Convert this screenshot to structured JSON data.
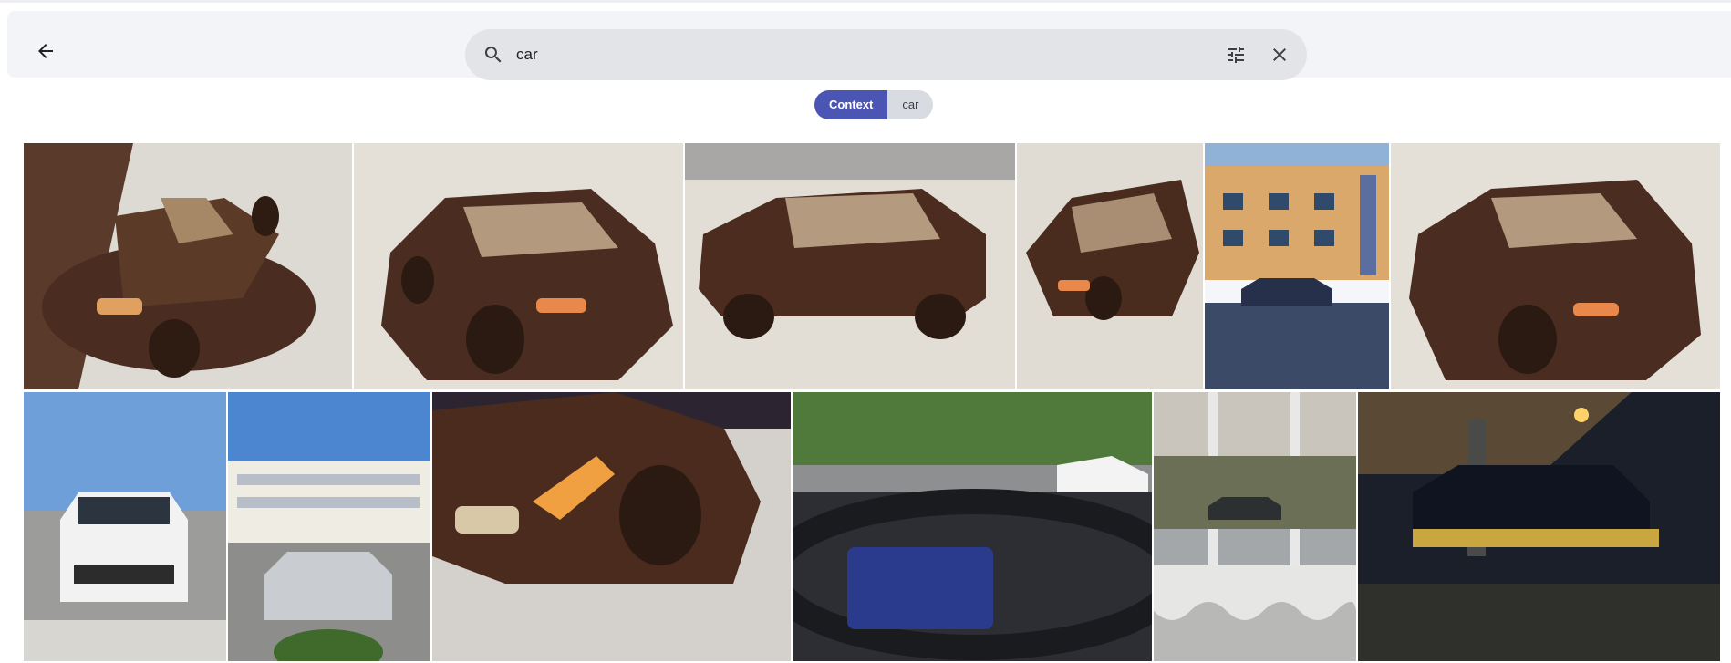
{
  "search": {
    "query": "car",
    "icon": "search-icon"
  },
  "toolbar": {
    "back_icon": "arrow-back-icon",
    "filter_icon": "tune-icon",
    "clear_icon": "close-icon"
  },
  "chips": [
    {
      "label": "Context",
      "active": true
    },
    {
      "label": "car",
      "active": false
    }
  ],
  "colors": {
    "accent": "#4b55b4",
    "chip_bg": "#d9dbe2",
    "header_bg": "#f3f4f7",
    "search_bg": "#e3e4e8"
  },
  "results": {
    "row1": [
      "chocolate-car-photo",
      "chocolate-car-photo",
      "chocolate-car-photo",
      "chocolate-car-photo",
      "building-street-photo",
      "chocolate-car-photo"
    ],
    "row2": [
      "white-suv-parking-photo",
      "silver-sedan-hotel-photo",
      "chocolate-car-closeup-photo",
      "dashboard-photo",
      "window-view-photo",
      "night-car-photo"
    ]
  }
}
